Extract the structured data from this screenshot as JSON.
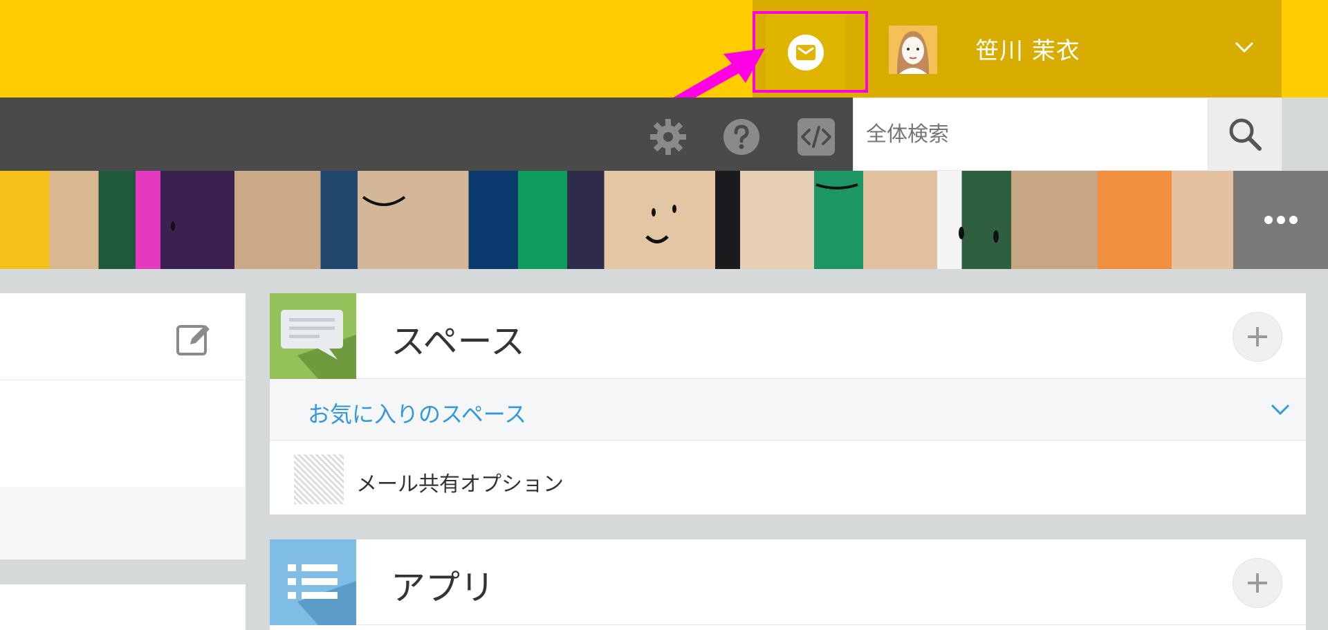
{
  "header": {
    "notification_icon": "mail-icon",
    "user_name": "笹川 茉衣",
    "colors": {
      "header_bg": "#ffcc00",
      "header_user_bg": "#d9ad00",
      "highlight": "#ff00e6"
    }
  },
  "toolbar": {
    "settings_icon": "gear-icon",
    "help_icon": "question-icon",
    "code_icon": "code-icon",
    "search_placeholder": "全体検索",
    "search_icon": "search-icon"
  },
  "spaces": {
    "title": "スペース",
    "favorites_label": "お気に入りのスペース",
    "items": [
      {
        "name": "メール共有オプション"
      }
    ]
  },
  "apps": {
    "title": "アプリ"
  }
}
